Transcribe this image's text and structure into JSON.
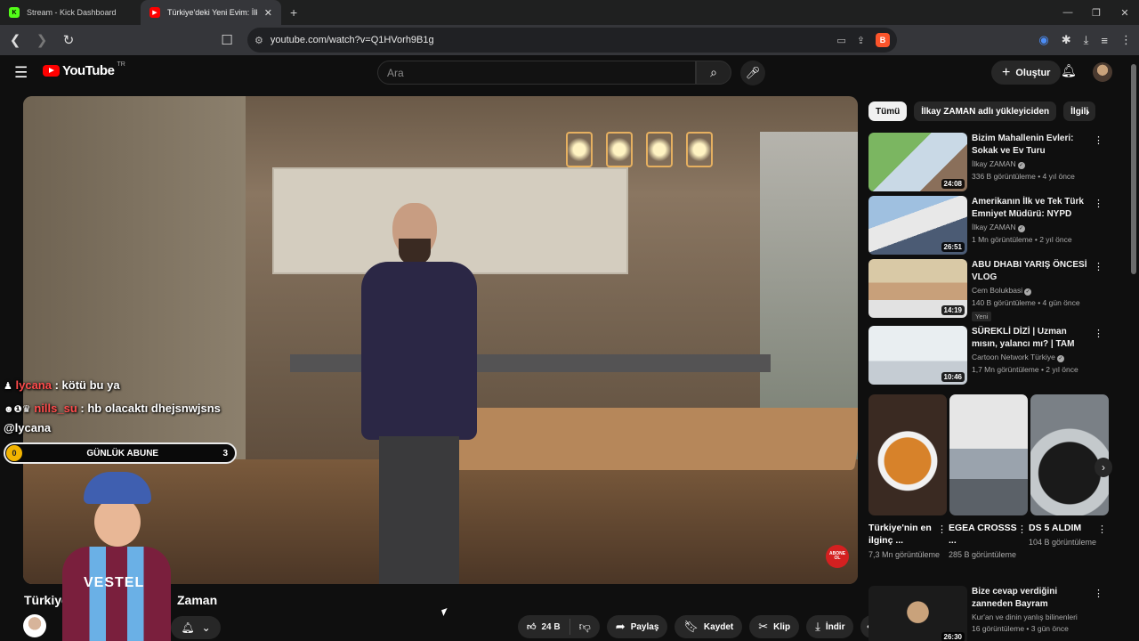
{
  "browser": {
    "tabs": [
      {
        "title": "Stream - Kick Dashboard",
        "active": false,
        "favicon": "kick-icon"
      },
      {
        "title": "Türkiye'deki Yeni Evim: İlkay Z",
        "active": true,
        "favicon": "youtube-icon"
      }
    ],
    "url": "youtube.com/watch?v=Q1HVorh9B1g"
  },
  "youtube": {
    "logo_text": "YouTube",
    "country_code": "TR",
    "search_placeholder": "Ara",
    "create_label": "Oluştur"
  },
  "overlay": {
    "chat": [
      {
        "user": "lycana",
        "message": ": kötü bu ya"
      },
      {
        "user": "nills_su",
        "message": ": hb olacaktı dhejsnwjsns"
      },
      {
        "user": "",
        "message": "@lycana"
      }
    ],
    "sub_goal": {
      "label": "GÜNLÜK ABUNE",
      "current": "0",
      "target": "3"
    },
    "jersey_text": "VESTEL",
    "abone_badge": "ABONE OL"
  },
  "video": {
    "title_start": "Türkiye",
    "title_end": "Zaman",
    "actions": {
      "likes": "24 B",
      "share": "Paylaş",
      "save": "Kaydet",
      "clip": "Klip",
      "download": "İndir"
    }
  },
  "sidebar": {
    "chips": [
      "Tümü",
      "İlkay ZAMAN adlı yükleyiciden",
      "İlgili"
    ],
    "recommendations": [
      {
        "title": "Bizim Mahallenin Evleri: Sokak ve Ev Turu",
        "channel": "İlkay ZAMAN",
        "views": "336 B görüntüleme • 4 yıl önce",
        "duration": "24:08",
        "badge": ""
      },
      {
        "title": "Amerikanın İlk ve Tek Türk Emniyet Müdürü: NYPD",
        "channel": "İlkay ZAMAN",
        "views": "1 Mn görüntüleme • 2 yıl önce",
        "duration": "26:51",
        "badge": ""
      },
      {
        "title": "ABU DHABI YARIŞ ÖNCESİ VLOG",
        "channel": "Cem Bolukbasi",
        "views": "140 B görüntüleme • 4 gün önce",
        "duration": "14:19",
        "badge": "Yeni"
      },
      {
        "title": "SÜREKLİ DİZİ | Uzman mısın, yalancı mı? | TAM BÖLÜM | ...",
        "channel": "Cartoon Network Türkiye",
        "views": "1,7 Mn görüntüleme • 2 yıl önce",
        "duration": "10:46",
        "badge": ""
      }
    ],
    "shorts": [
      {
        "title": "Türkiye'nin en ilginç ...",
        "views": "7,3 Mn görüntüleme"
      },
      {
        "title": "EGEA CROSSS ...",
        "views": "285 B görüntüleme"
      },
      {
        "title": "DS 5 ALDIM",
        "views": "104 B görüntüleme"
      }
    ],
    "bottom_rec": {
      "title": "Bize cevap verdiğini zanneden Bayram Maraşlı'ya reddiye",
      "channel": "Kur'an ve dinin yanlış bilinenleri",
      "views": "16 görüntüleme • 3 gün önce",
      "duration": "26:30"
    }
  }
}
